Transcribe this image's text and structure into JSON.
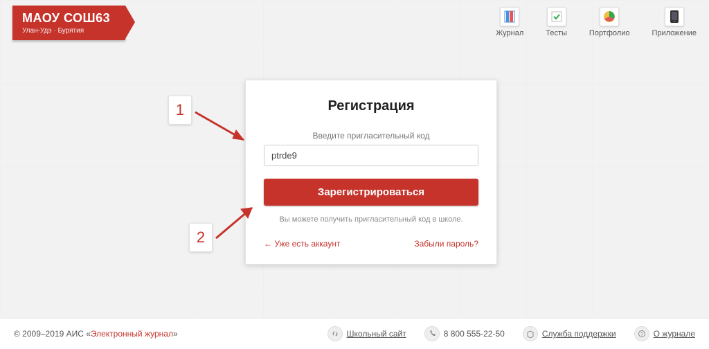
{
  "logo": {
    "title": "МАОУ СОШ63",
    "subtitle": "Улан-Удэ · Бурятия"
  },
  "nav": {
    "journal": "Журнал",
    "tests": "Тесты",
    "portfolio": "Портфолио",
    "app": "Приложение"
  },
  "card": {
    "title": "Регистрация",
    "label": "Введите пригласительный код",
    "input_value": "ptrde9",
    "button": "Зарегистрироваться",
    "hint": "Вы можете получить пригласительный код в школе.",
    "login_link": "← Уже есть аккаунт",
    "forgot_link": "Забыли пароль?"
  },
  "steps": {
    "one": "1",
    "two": "2"
  },
  "footer": {
    "copy_prefix": "© 2009–2019 АИС «",
    "copy_link": "Электронный журнал",
    "copy_suffix": "»",
    "site": "Школьный сайт",
    "phone": "8 800 555-22-50",
    "support": "Служба поддержки",
    "about": "О журнале"
  }
}
